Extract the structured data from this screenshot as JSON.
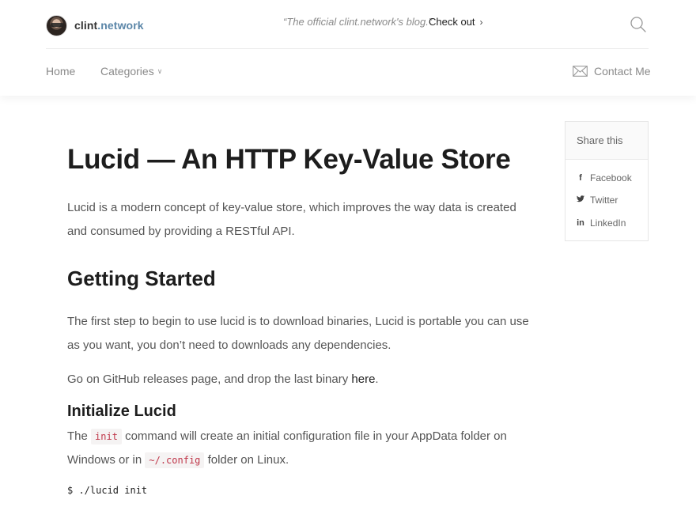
{
  "header": {
    "brand_name_prefix": "clint",
    "brand_name_suffix": ".network",
    "tagline": "“The official clint.network's blog.”",
    "checkout_label": "Check out",
    "nav": {
      "home": "Home",
      "categories": "Categories"
    },
    "contact_label": "Contact Me"
  },
  "article": {
    "title": "Lucid — An HTTP Key-Value Store",
    "intro": "Lucid is a modern concept of key-value store, which improves the way data is created and consumed by providing a RESTful API.",
    "getting_started": {
      "heading": "Getting Started",
      "step1": "The first step to begin to use lucid is to download binaries, Lucid is portable you can use as you want, you don’t need to downloads any dependencies.",
      "step2_prefix": "Go on GitHub releases page, and drop the last binary ",
      "step2_link": "here",
      "step2_suffix": "."
    },
    "initialize": {
      "heading": "Initialize Lucid",
      "text_1": "The ",
      "code_1": "init",
      "text_2": " command will create an initial configuration file in your AppData folder on Windows or in ",
      "code_2": "~/.config",
      "text_3": " folder on Linux.",
      "command": "$ ./lucid init"
    }
  },
  "share": {
    "heading": "Share this",
    "items": [
      {
        "label": "Facebook",
        "icon": "facebook-icon"
      },
      {
        "label": "Twitter",
        "icon": "twitter-icon"
      },
      {
        "label": "LinkedIn",
        "icon": "linkedin-icon"
      }
    ]
  },
  "colors": {
    "brand_accent": "#5b86a8",
    "inline_code": "#c0374a",
    "muted_text": "#8a8a8a"
  }
}
